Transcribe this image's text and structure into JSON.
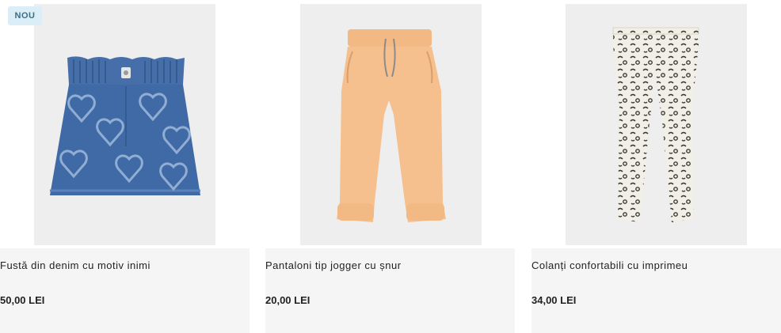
{
  "products": [
    {
      "badge": "NOU",
      "title": "Fustă din denim cu motiv inimi",
      "price": "50,00 LEI"
    },
    {
      "title": "Pantaloni tip jogger cu șnur",
      "price": "20,00 LEI"
    },
    {
      "title": "Colanți confortabili cu imprimeu",
      "price": "34,00 LEI"
    }
  ],
  "colors": {
    "denim": "#3f6aa6",
    "peach": "#f6c08e",
    "leopard_base": "#f1efe6",
    "leopard_spot": "#3a3a3a",
    "badge_bg": "#dbeef7",
    "card_bg": "#f5f5f5"
  }
}
